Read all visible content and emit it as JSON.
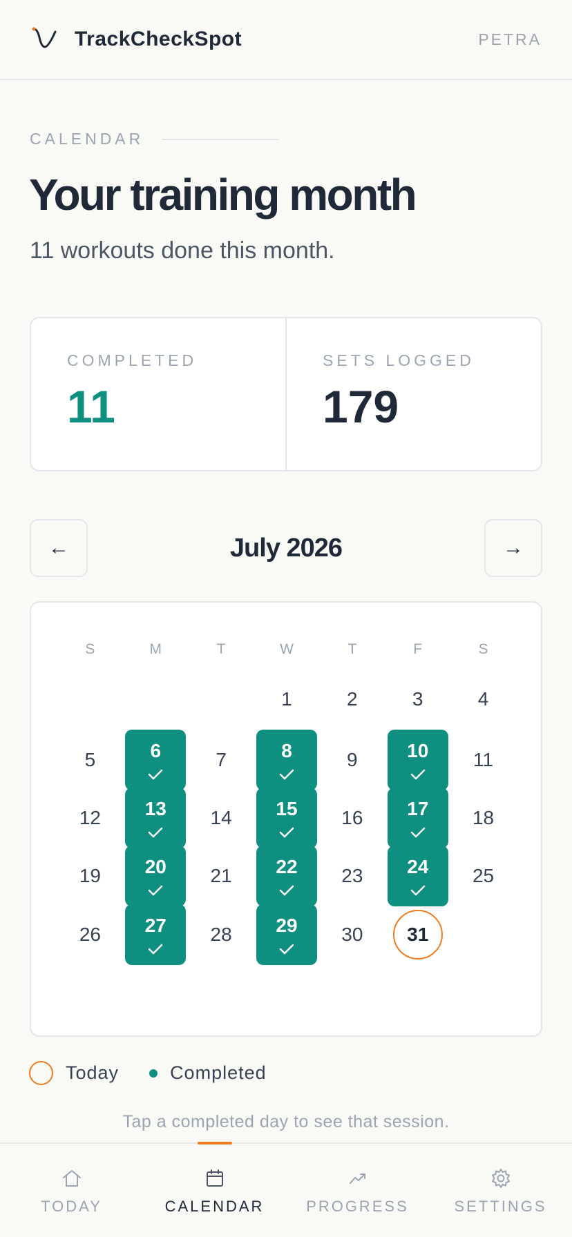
{
  "header": {
    "app_name": "TrackCheckSpot",
    "user": "PETRA"
  },
  "section_label": "CALENDAR",
  "title": "Your training month",
  "subtitle": "11 workouts done this month.",
  "stats": [
    {
      "label": "COMPLETED",
      "value": "11"
    },
    {
      "label": "SETS LOGGED",
      "value": "179"
    }
  ],
  "calendar": {
    "month_label": "July 2026",
    "prev_label": "←",
    "next_label": "→",
    "weekdays": [
      "S",
      "M",
      "T",
      "W",
      "T",
      "F",
      "S"
    ],
    "weeks": [
      [
        "",
        "",
        "",
        "1",
        "2",
        "3",
        "4"
      ],
      [
        "5",
        "6",
        "7",
        "8",
        "9",
        "10",
        "11"
      ],
      [
        "12",
        "13",
        "14",
        "15",
        "16",
        "17",
        "18"
      ],
      [
        "19",
        "20",
        "21",
        "22",
        "23",
        "24",
        "25"
      ],
      [
        "26",
        "27",
        "28",
        "29",
        "30",
        "31",
        ""
      ]
    ],
    "completed_days": [
      "6",
      "8",
      "10",
      "13",
      "15",
      "17",
      "20",
      "22",
      "24",
      "27",
      "29"
    ],
    "today": "31"
  },
  "legend": {
    "today_label": "Today",
    "completed_label": "Completed"
  },
  "hint": "Tap a completed day to see that session.",
  "nav": [
    {
      "label": "TODAY",
      "icon": "home-icon",
      "active": false
    },
    {
      "label": "CALENDAR",
      "icon": "calendar-icon",
      "active": true
    },
    {
      "label": "PROGRESS",
      "icon": "trend-up-icon",
      "active": false
    },
    {
      "label": "SETTINGS",
      "icon": "gear-icon",
      "active": false
    }
  ],
  "colors": {
    "accent": "#0f8f7f",
    "today_ring": "#f07b1f",
    "background": "#f9f9f6"
  }
}
